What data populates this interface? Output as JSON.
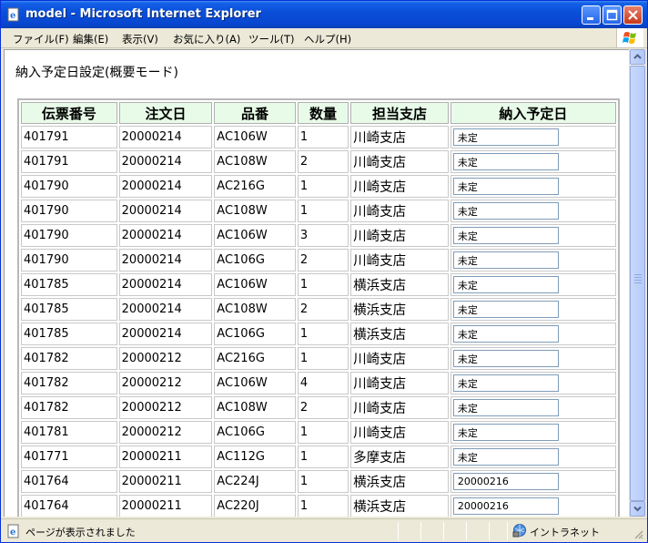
{
  "window": {
    "title": "model - Microsoft Internet Explorer"
  },
  "menu": [
    {
      "label": "ファイル(F)"
    },
    {
      "label": "編集(E)"
    },
    {
      "label": "表示(V)"
    },
    {
      "label": "お気に入り(A)"
    },
    {
      "label": "ツール(T)"
    },
    {
      "label": "ヘルプ(H)"
    }
  ],
  "page": {
    "title": "納入予定日設定(概要モード)"
  },
  "table": {
    "headers": [
      "伝票番号",
      "注文日",
      "品番",
      "数量",
      "担当支店",
      "納入予定日"
    ],
    "rows": [
      {
        "slip": "401791",
        "order_date": "20000214",
        "part": "AC106W",
        "qty": "1",
        "branch": "川崎支店",
        "delivery": "未定"
      },
      {
        "slip": "401791",
        "order_date": "20000214",
        "part": "AC108W",
        "qty": "2",
        "branch": "川崎支店",
        "delivery": "未定"
      },
      {
        "slip": "401790",
        "order_date": "20000214",
        "part": "AC216G",
        "qty": "1",
        "branch": "川崎支店",
        "delivery": "未定"
      },
      {
        "slip": "401790",
        "order_date": "20000214",
        "part": "AC108W",
        "qty": "1",
        "branch": "川崎支店",
        "delivery": "未定"
      },
      {
        "slip": "401790",
        "order_date": "20000214",
        "part": "AC106W",
        "qty": "3",
        "branch": "川崎支店",
        "delivery": "未定"
      },
      {
        "slip": "401790",
        "order_date": "20000214",
        "part": "AC106G",
        "qty": "2",
        "branch": "川崎支店",
        "delivery": "未定"
      },
      {
        "slip": "401785",
        "order_date": "20000214",
        "part": "AC106W",
        "qty": "1",
        "branch": "横浜支店",
        "delivery": "未定"
      },
      {
        "slip": "401785",
        "order_date": "20000214",
        "part": "AC108W",
        "qty": "2",
        "branch": "横浜支店",
        "delivery": "未定"
      },
      {
        "slip": "401785",
        "order_date": "20000214",
        "part": "AC106G",
        "qty": "1",
        "branch": "横浜支店",
        "delivery": "未定"
      },
      {
        "slip": "401782",
        "order_date": "20000212",
        "part": "AC216G",
        "qty": "1",
        "branch": "川崎支店",
        "delivery": "未定"
      },
      {
        "slip": "401782",
        "order_date": "20000212",
        "part": "AC106W",
        "qty": "4",
        "branch": "川崎支店",
        "delivery": "未定"
      },
      {
        "slip": "401782",
        "order_date": "20000212",
        "part": "AC108W",
        "qty": "2",
        "branch": "川崎支店",
        "delivery": "未定"
      },
      {
        "slip": "401781",
        "order_date": "20000212",
        "part": "AC106G",
        "qty": "1",
        "branch": "川崎支店",
        "delivery": "未定"
      },
      {
        "slip": "401771",
        "order_date": "20000211",
        "part": "AC112G",
        "qty": "1",
        "branch": "多摩支店",
        "delivery": "未定"
      },
      {
        "slip": "401764",
        "order_date": "20000211",
        "part": "AC224J",
        "qty": "1",
        "branch": "横浜支店",
        "delivery": "20000216"
      },
      {
        "slip": "401764",
        "order_date": "20000211",
        "part": "AC220J",
        "qty": "1",
        "branch": "横浜支店",
        "delivery": "20000216"
      }
    ]
  },
  "status": {
    "text": "ページが表示されました",
    "zone": "イントラネット"
  },
  "icons": {
    "window": "ie-page-icon",
    "status": "ie-page-icon",
    "zone": "intranet-globe-icon",
    "brand": "windows-flag-icon"
  },
  "colors": {
    "titlebar": "#0a4fd8",
    "header_bg": "#e8fbe8",
    "close_button": "#c63a1c"
  }
}
